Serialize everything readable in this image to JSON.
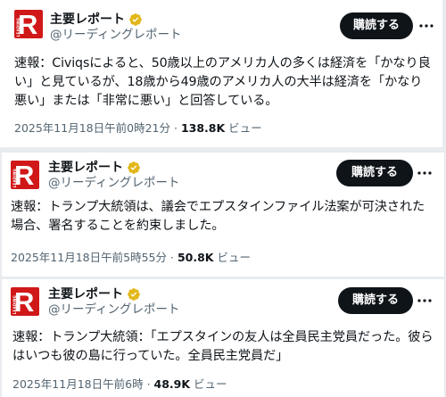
{
  "posts": [
    {
      "author": {
        "name": "主要レポート",
        "handle": "@リーディングレポート",
        "verified": true,
        "avatar_letter": "R",
        "avatar_subtext": "LEADING",
        "avatar_color": "#d01818"
      },
      "subscribe_label": "購読する",
      "text": "速報：Civiqsによると、50歳以上のアメリカ人の多くは経済を「かなり良い」と見ているが、18歳から49歳のアメリカ人の大半は経済を「かなり悪い」または「非常に悪い」と回答している。",
      "timestamp": "2025年11月18日午前0時21分",
      "separator": "·",
      "views_count": "138.8K",
      "views_label": "ビュー"
    },
    {
      "author": {
        "name": "主要レポート",
        "handle": "@リーディングレポート",
        "verified": true,
        "avatar_letter": "R",
        "avatar_subtext": "LEADING",
        "avatar_color": "#d01818"
      },
      "subscribe_label": "購読する",
      "text": "速報：トランプ大統領は、議会でエプスタインファイル法案が可決された場合、署名することを約束しました。",
      "timestamp": "2025年11月18日午前5時55分",
      "separator": "·",
      "views_count": "50.8K",
      "views_label": "ビュー"
    },
    {
      "author": {
        "name": "主要レポート",
        "handle": "@リーディングレポート",
        "verified": true,
        "avatar_letter": "R",
        "avatar_subtext": "LEADING",
        "avatar_color": "#d01818"
      },
      "subscribe_label": "購読する",
      "text": "速報：トランプ大統領：「エプスタインの友人は全員民主党員だった。彼らはいつも彼の島に行っていた。全員民主党員だ」",
      "timestamp": "2025年11月18日午前6時",
      "separator": "·",
      "views_count": "48.9K",
      "views_label": "ビュー"
    }
  ],
  "colors": {
    "accent": "#0f1419",
    "muted": "#536471",
    "verified_gold": "#e2b719",
    "background": "#e9ecef"
  },
  "icons": {
    "verified": "verified-badge-icon",
    "more": "more-horizontal-icon"
  }
}
